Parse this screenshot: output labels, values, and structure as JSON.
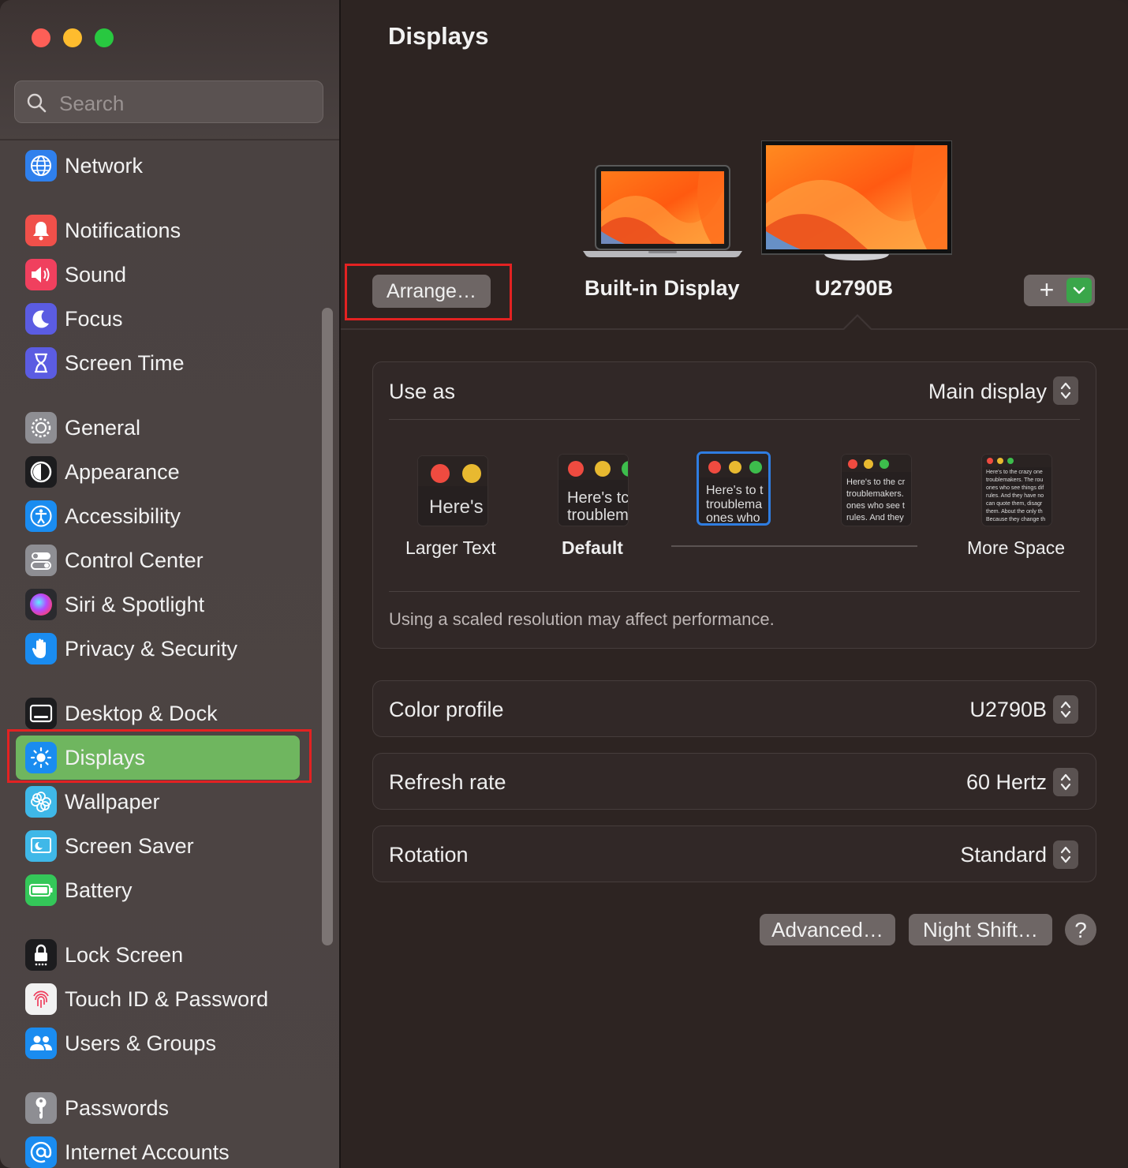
{
  "window": {
    "traffic_lights": {
      "close": "#fe5f57",
      "minimize": "#febc2e",
      "zoom": "#28c840"
    }
  },
  "sidebar": {
    "search": {
      "placeholder": "Search",
      "value": ""
    },
    "items": [
      {
        "label": "Network",
        "icon": "globe-icon",
        "color": "#2f80ed"
      },
      {
        "label": "Notifications",
        "icon": "bell-icon",
        "color": "#f0504a"
      },
      {
        "label": "Sound",
        "icon": "speaker-icon",
        "color": "#f0405e"
      },
      {
        "label": "Focus",
        "icon": "moon-icon",
        "color": "#5b5ce2"
      },
      {
        "label": "Screen Time",
        "icon": "hourglass-icon",
        "color": "#5b5ce2"
      },
      {
        "label": "General",
        "icon": "gear-icon",
        "color": "#8e8e93"
      },
      {
        "label": "Appearance",
        "icon": "appearance-icon",
        "color": "#1c1c1e"
      },
      {
        "label": "Accessibility",
        "icon": "accessibility-icon",
        "color": "#1a8cf0"
      },
      {
        "label": "Control Center",
        "icon": "toggles-icon",
        "color": "#8e8e93"
      },
      {
        "label": "Siri & Spotlight",
        "icon": "siri-icon",
        "color": "#2a2a2e"
      },
      {
        "label": "Privacy & Security",
        "icon": "hand-icon",
        "color": "#1a8cf0"
      },
      {
        "label": "Desktop & Dock",
        "icon": "dock-icon",
        "color": "#1c1c1e"
      },
      {
        "label": "Displays",
        "icon": "sun-icon",
        "color": "#1a8cf0"
      },
      {
        "label": "Wallpaper",
        "icon": "flower-icon",
        "color": "#3fb8e8"
      },
      {
        "label": "Screen Saver",
        "icon": "screensaver-icon",
        "color": "#3fb8e8"
      },
      {
        "label": "Battery",
        "icon": "battery-icon",
        "color": "#34c759"
      },
      {
        "label": "Lock Screen",
        "icon": "lock-icon",
        "color": "#1c1c1e"
      },
      {
        "label": "Touch ID & Password",
        "icon": "fingerprint-icon",
        "color": "#f2f2f2"
      },
      {
        "label": "Users & Groups",
        "icon": "users-icon",
        "color": "#1a8cf0"
      },
      {
        "label": "Passwords",
        "icon": "key-icon",
        "color": "#8e8e93"
      },
      {
        "label": "Internet Accounts",
        "icon": "at-icon",
        "color": "#1a8cf0"
      }
    ],
    "selected": "Displays"
  },
  "main": {
    "title": "Displays",
    "arrange_label": "Arrange…",
    "displays": [
      {
        "label": "Built-in Display",
        "icon": "laptop-icon"
      },
      {
        "label": "U2790B",
        "icon": "monitor-icon",
        "selected": true
      }
    ],
    "add_label": "+",
    "use_as": {
      "label": "Use as",
      "value": "Main display"
    },
    "resolution": {
      "options": [
        {
          "label": "Larger Text",
          "preview": "Here's"
        },
        {
          "label": "Default",
          "preview": "Here's tc\ntroublem"
        },
        {
          "label": "",
          "preview": "Here's to t\ntroublema\nones who",
          "selected": true
        },
        {
          "label": "",
          "preview": "Here's to the cr\ntroublemakers.\nones who see t\nrules. And they"
        },
        {
          "label": "More Space",
          "preview": "Here's to the crazy one\ntroublemakers. The rou\nones who see things dif\nrules. And they have no\ncan quote them, disagr\nthem. About the only th\nBecause they change th"
        }
      ],
      "note": "Using a scaled resolution may affect performance."
    },
    "color_profile": {
      "label": "Color profile",
      "value": "U2790B"
    },
    "refresh_rate": {
      "label": "Refresh rate",
      "value": "60 Hertz"
    },
    "rotation": {
      "label": "Rotation",
      "value": "Standard"
    },
    "buttons": {
      "advanced": "Advanced…",
      "night_shift": "Night Shift…",
      "help": "?"
    }
  }
}
